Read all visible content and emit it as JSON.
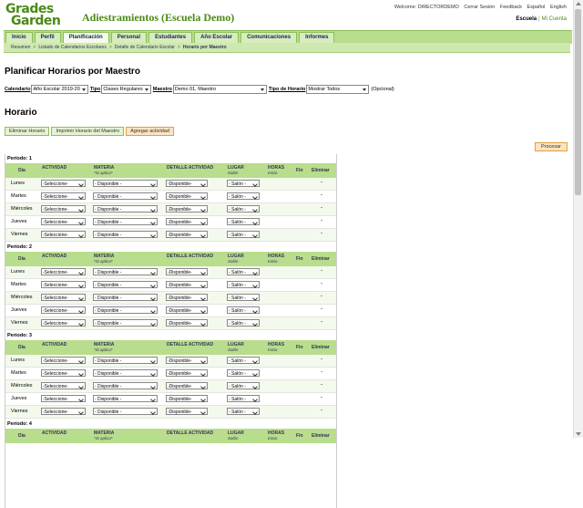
{
  "logo": {
    "line1": "Grades",
    "line2": "Garden"
  },
  "site_title": "Adiestramientos (Escuela Demo)",
  "top_links": [
    "Welcome: DIRECTORDEMO",
    "Cerrar Sesión",
    "Feedback",
    "Español",
    "English"
  ],
  "school_links": {
    "school": "Escuela",
    "sep": "|",
    "account": "Mi Cuenta"
  },
  "nav": [
    "Inicio",
    "Perfil",
    "Planificación",
    "Personal",
    "Estudiantes",
    "Año Escolar",
    "Comunicaciones",
    "Informes"
  ],
  "nav_active": 2,
  "breadcrumb": [
    "Resumen",
    "Listado de Calendarios Escolares",
    "Detalle de Calendario Escolar",
    "Horario por Maestro"
  ],
  "breadcrumb_sep": ">",
  "page_title": "Planificar Horarios por Maestro",
  "filters": {
    "calendario_label": "Calendario",
    "calendario_value": "Año Escolar 2019-20",
    "tipo_label": "Tipo",
    "tipo_value": "Clases Regulares",
    "maestro_label": "Maestro",
    "maestro_value": "Demo 01, Maestro",
    "tipo_horario_label": "Tipo de Horario",
    "tipo_horario_value": "Mostrar Todos",
    "opcional": "(Opcional)"
  },
  "section_title": "Horario",
  "actions": {
    "eliminar": "Eliminar Horario",
    "imprimir": "Imprimir Horario del Maestro",
    "agregar": "Agregar actividad"
  },
  "procesar": "Procesar",
  "headers": {
    "dia": "Día",
    "actividad": "ACTIVIDAD",
    "materia": "MATERIA",
    "materia_sub": "*Si aplica*",
    "detalle": "DETALLE ACTIVIDAD",
    "lugar": "LUGAR",
    "lugar_sub": "Salón",
    "horas": "HORAS",
    "inicio": "Inicio",
    "fin": "Fin",
    "eliminar": "Eliminar"
  },
  "days": [
    "Lunes",
    "Martes",
    "Miércoles",
    "Jueves",
    "Viernes"
  ],
  "dropdowns": {
    "actividad": "-Seleccione-",
    "materia": "- Disponible -",
    "detalle": "-Disponible-",
    "lugar": "- Salón -"
  },
  "dash": "-",
  "periods": [
    "Período: 1",
    "Período: 2",
    "Período: 3",
    "Período: 4"
  ]
}
